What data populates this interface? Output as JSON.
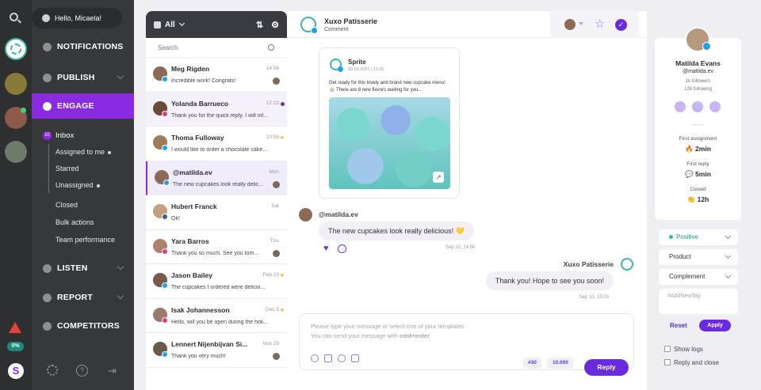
{
  "colors": {
    "accent": "#7b2ee6",
    "rail": "#2e2f31",
    "nav": "#36383a",
    "engage": "#8a2be2"
  },
  "greeting": "Hello, Micaela!",
  "nav": {
    "notifications": "NOTIFICATIONS",
    "publish": "PUBLISH",
    "engage": "ENGAGE",
    "inbox": "Inbox",
    "inbox_count": "10",
    "assigned": "Assigned to me",
    "starred": "Starred",
    "unassigned": "Unassigned",
    "closed": "Closed",
    "bulk": "Bulk actions",
    "team": "Team performance",
    "listen": "LISTEN",
    "report": "REPORT",
    "competitors": "COMPETITORS",
    "percent": "0%"
  },
  "list": {
    "filter": "All",
    "search_placeholder": "Search",
    "rows": [
      {
        "name": "Meg Rigden",
        "time": "14:56",
        "msg": "Incredible work! Congrats!",
        "mark": ""
      },
      {
        "name": "Yolanda Barrueco",
        "time": "12:23",
        "msg": "Thank you for the quick reply. I will inf...",
        "mark": "dot"
      },
      {
        "name": "Thoma Fulloway",
        "time": "10:05",
        "msg": "I would like to order a chocolate cake...",
        "mark": "star"
      },
      {
        "name": "@matilda.ev",
        "time": "Mon",
        "msg": "The new cupcakes look really delic...",
        "mark": ""
      },
      {
        "name": "Hubert Franck",
        "time": "Sat",
        "msg": "Ok!",
        "mark": ""
      },
      {
        "name": "Yara Barros",
        "time": "Thu",
        "msg": "Thank you so much. See you tom...",
        "mark": ""
      },
      {
        "name": "Jason Bailey",
        "time": "Feb 23",
        "msg": "The cupcakes I ordered were delicio...",
        "mark": "star"
      },
      {
        "name": "Isak Johannesson",
        "time": "Dec 5",
        "msg": "Hello, will you be open during the holi...",
        "mark": "star"
      },
      {
        "name": "Lennert Nijenbijvan Si...",
        "time": "Nov 29",
        "msg": "Thank you very much!",
        "mark": ""
      }
    ]
  },
  "conv": {
    "account": "Xuxo Patisserie",
    "type": "Comment",
    "post_author": "Sprite",
    "post_date": "09.09.2021 / 11:20",
    "post_text": "Get ready for this lovely and brand new cupcake menu! 🧁 There are 8 new flavors waiting for you...",
    "in_user": "@matilda.ev",
    "in_msg": "The new cupcakes look really delicious! 💛",
    "in_time": "Sep 10, 14:56",
    "out_user": "Xuxo Patisserie",
    "out_msg": "Thank you! Hope to see you soon!",
    "out_time": "Sep 10, 15:00",
    "reply_placeholder_1": "Please type your message or select one of your templates.",
    "reply_placeholder_2_pre": "You can send your message with ",
    "reply_placeholder_2_key": "cmd+enter",
    "tag_count": "#30",
    "char_count": "10.000",
    "reply_button": "Reply"
  },
  "profile": {
    "name": "Matilda Evans",
    "handle": "@matilda.ev",
    "followers": "1k followers",
    "following": "126 following",
    "first_assignment_label": "First assignment",
    "first_assignment": "2min",
    "first_reply_label": "First reply",
    "first_reply": "5min",
    "closed_label": "Closed",
    "closed": "12h"
  },
  "side": {
    "sentiment": "Positive",
    "product": "Product",
    "complement": "Complement",
    "tag_placeholder": "#AddNewTag",
    "reset": "Reset",
    "apply": "Apply",
    "show_logs": "Show logs",
    "reply_close": "Reply and close"
  }
}
